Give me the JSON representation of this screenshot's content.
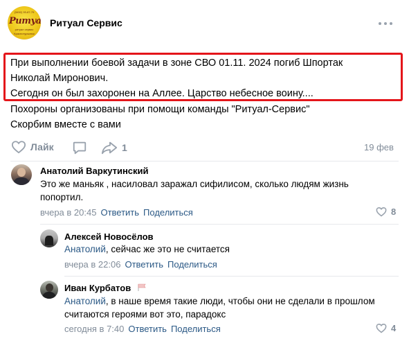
{
  "group": {
    "name": "Ритуал Сервис",
    "logo_text": "Ритуал",
    "logo_small_top": "(3452) 93-87-79",
    "logo_small_bottom": "ритуал сервис",
    "logo_small_city": "Краснотурьинск",
    "more_icon": "more-horizontal-icon"
  },
  "post": {
    "lines": [
      "При выполнении боевой задачи в зоне СВО 01.11. 2024 погиб Шпортак",
      "Николай Миронович.",
      "Сегодня он был захоронен на Аллее. Царство небесное воину....",
      "Похороны организованы при помощи команды \"Ритуал-Сервис\"",
      "Скорбим вместе с вами"
    ],
    "highlight_color": "#e4151a",
    "like_label": "Лайк",
    "share_count": "1",
    "date": "19 фев"
  },
  "comments": [
    {
      "author": "Анатолий Варкутинский",
      "text_lines": [
        "Это же маньяк , насиловал заражал сифилисом, сколько людям жизнь",
        "попортил."
      ],
      "time": "вчера в 20:45",
      "reply_label": "Ответить",
      "share_label": "Поделиться",
      "likes": "8"
    },
    {
      "author": "Алексей Новосёлов",
      "mention": "Анатолий",
      "text_lines": [
        ", сейчас же это не считается"
      ],
      "time": "вчера в 22:06",
      "reply_label": "Ответить",
      "share_label": "Поделиться"
    },
    {
      "author": "Иван Курбатов",
      "mention": "Анатолий",
      "text_lines": [
        ", в наше время такие люди, чтобы они не сделали в прошлом",
        "считаются героями вот это, парадокс"
      ],
      "time": "сегодня в 7:40",
      "reply_label": "Ответить",
      "share_label": "Поделиться",
      "likes": "4"
    }
  ],
  "colors": {
    "link": "#2a5885",
    "meta": "#818c99",
    "icon": "#99a2ad"
  }
}
